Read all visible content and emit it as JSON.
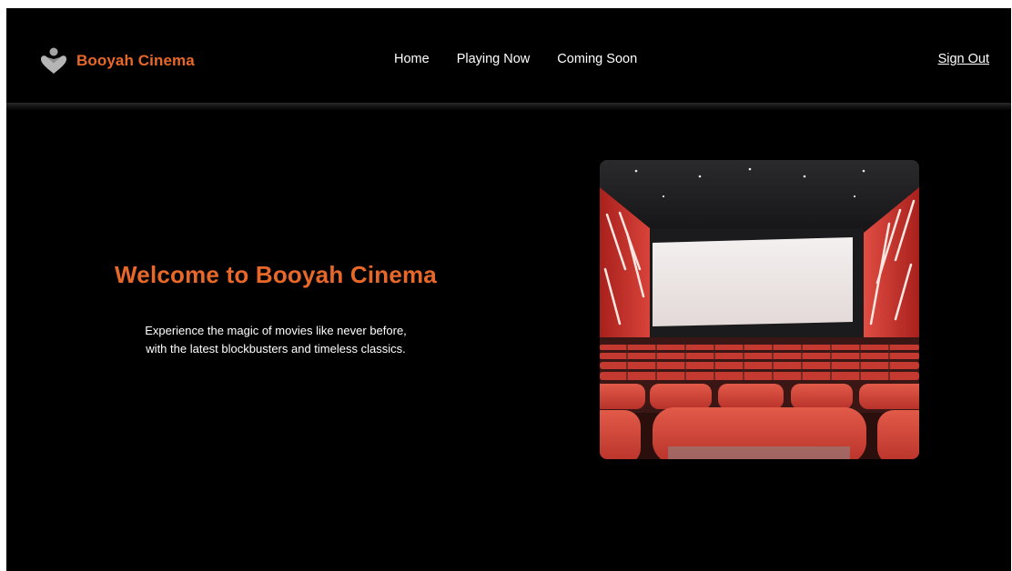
{
  "brand": {
    "name": "Booyah Cinema",
    "icon": "heart-hand-icon",
    "accent_color": "#e8682a"
  },
  "nav": {
    "links": [
      {
        "label": "Home"
      },
      {
        "label": "Playing Now"
      },
      {
        "label": "Coming Soon"
      }
    ],
    "sign_out": "Sign Out"
  },
  "hero": {
    "title": "Welcome to Booyah Cinema",
    "subtitle_lines": [
      "Experience the magic of movies like never before,",
      "with the latest blockbusters and timeless classics."
    ],
    "image": "cinema-theater-image"
  },
  "colors": {
    "background": "#000000",
    "text": "#ffffff",
    "accent": "#e8682a",
    "seat_red": "#c8392b"
  }
}
